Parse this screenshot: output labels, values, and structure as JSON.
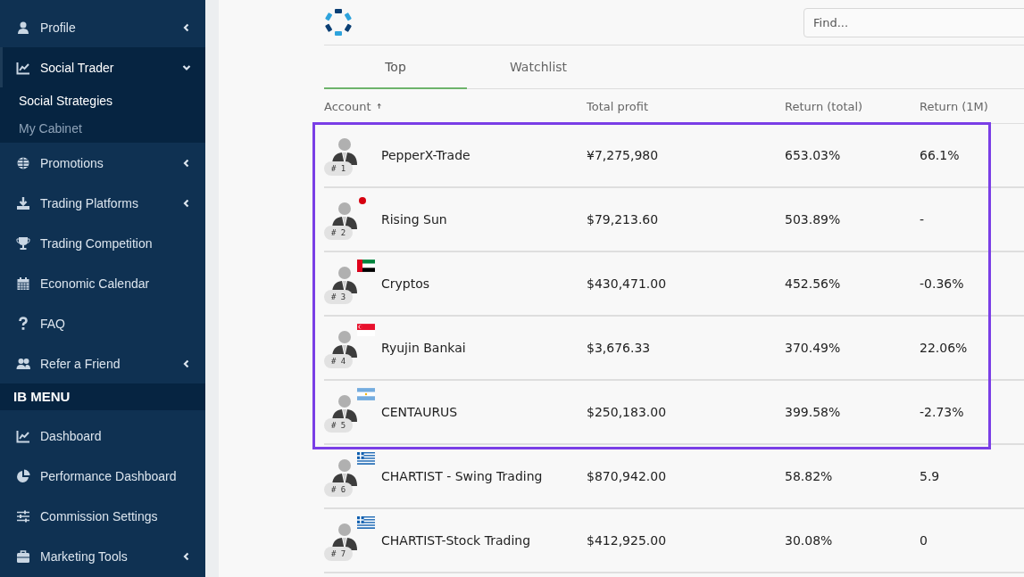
{
  "sidebar": {
    "items": [
      {
        "label": "Profile",
        "expanded": false,
        "selected": false
      },
      {
        "label": "Social Trader",
        "expanded": true,
        "selected": true,
        "children": [
          {
            "label": "Social Strategies",
            "selected": true
          },
          {
            "label": "My Cabinet",
            "selected": false
          }
        ]
      },
      {
        "label": "Promotions",
        "expanded": false,
        "selected": false
      },
      {
        "label": "Trading Platforms",
        "expanded": false,
        "selected": false
      },
      {
        "label": "Trading Competition",
        "selected": false
      },
      {
        "label": "Economic Calendar",
        "selected": false
      },
      {
        "label": "FAQ",
        "selected": false
      },
      {
        "label": "Refer a Friend",
        "expanded": false,
        "selected": false
      }
    ],
    "ib_menu": {
      "title": "IB MENU",
      "items": [
        {
          "label": "Dashboard",
          "selected": false
        },
        {
          "label": "Performance Dashboard",
          "selected": false
        },
        {
          "label": "Commission Settings",
          "selected": false
        },
        {
          "label": "Marketing Tools",
          "expanded": false,
          "selected": false
        }
      ]
    }
  },
  "search": {
    "placeholder": "Find..."
  },
  "tabs": [
    {
      "label": "Top",
      "selected": true
    },
    {
      "label": "Watchlist",
      "selected": false
    }
  ],
  "table": {
    "columns": [
      "Account",
      "Total profit",
      "Return (total)",
      "Return (1M)"
    ],
    "highlighted_rows": [
      {
        "rank": "# 1",
        "account": "PepperX-Trade",
        "total_profit": "¥7,275,980",
        "return_total": "653.03%",
        "return_1m": "66.1%"
      },
      {
        "rank": "# 2",
        "flag": {
          "kind": "jp"
        },
        "account": "Rising Sun",
        "total_profit": "$79,213.60",
        "return_total": "503.89%",
        "return_1m": "-"
      },
      {
        "rank": "# 3",
        "flag": {
          "kind": "ae"
        },
        "account": "Cryptos",
        "total_profit": "$430,471.00",
        "return_total": "452.56%",
        "return_1m": "-0.36%"
      },
      {
        "rank": "# 4",
        "flag": {
          "kind": "sg"
        },
        "account": "Ryujin Bankai",
        "total_profit": "$3,676.33",
        "return_total": "370.49%",
        "return_1m": "22.06%"
      },
      {
        "rank": "# 5",
        "flag": {
          "kind": "ar"
        },
        "account": "CENTAURUS",
        "total_profit": "$250,183.00",
        "return_total": "399.58%",
        "return_1m": "-2.73%"
      }
    ],
    "rows": [
      {
        "rank": "# 6",
        "flag": {
          "kind": "gr"
        },
        "account": "CHARTIST - Swing Trading",
        "total_profit": "$870,942.00",
        "return_total": "58.82%",
        "return_1m": "5.9"
      },
      {
        "rank": "# 7",
        "flag": {
          "kind": "gr"
        },
        "account": "CHARTIST-Stock Trading",
        "total_profit": "$412,925.00",
        "return_total": "30.08%",
        "return_1m": "0"
      }
    ]
  }
}
